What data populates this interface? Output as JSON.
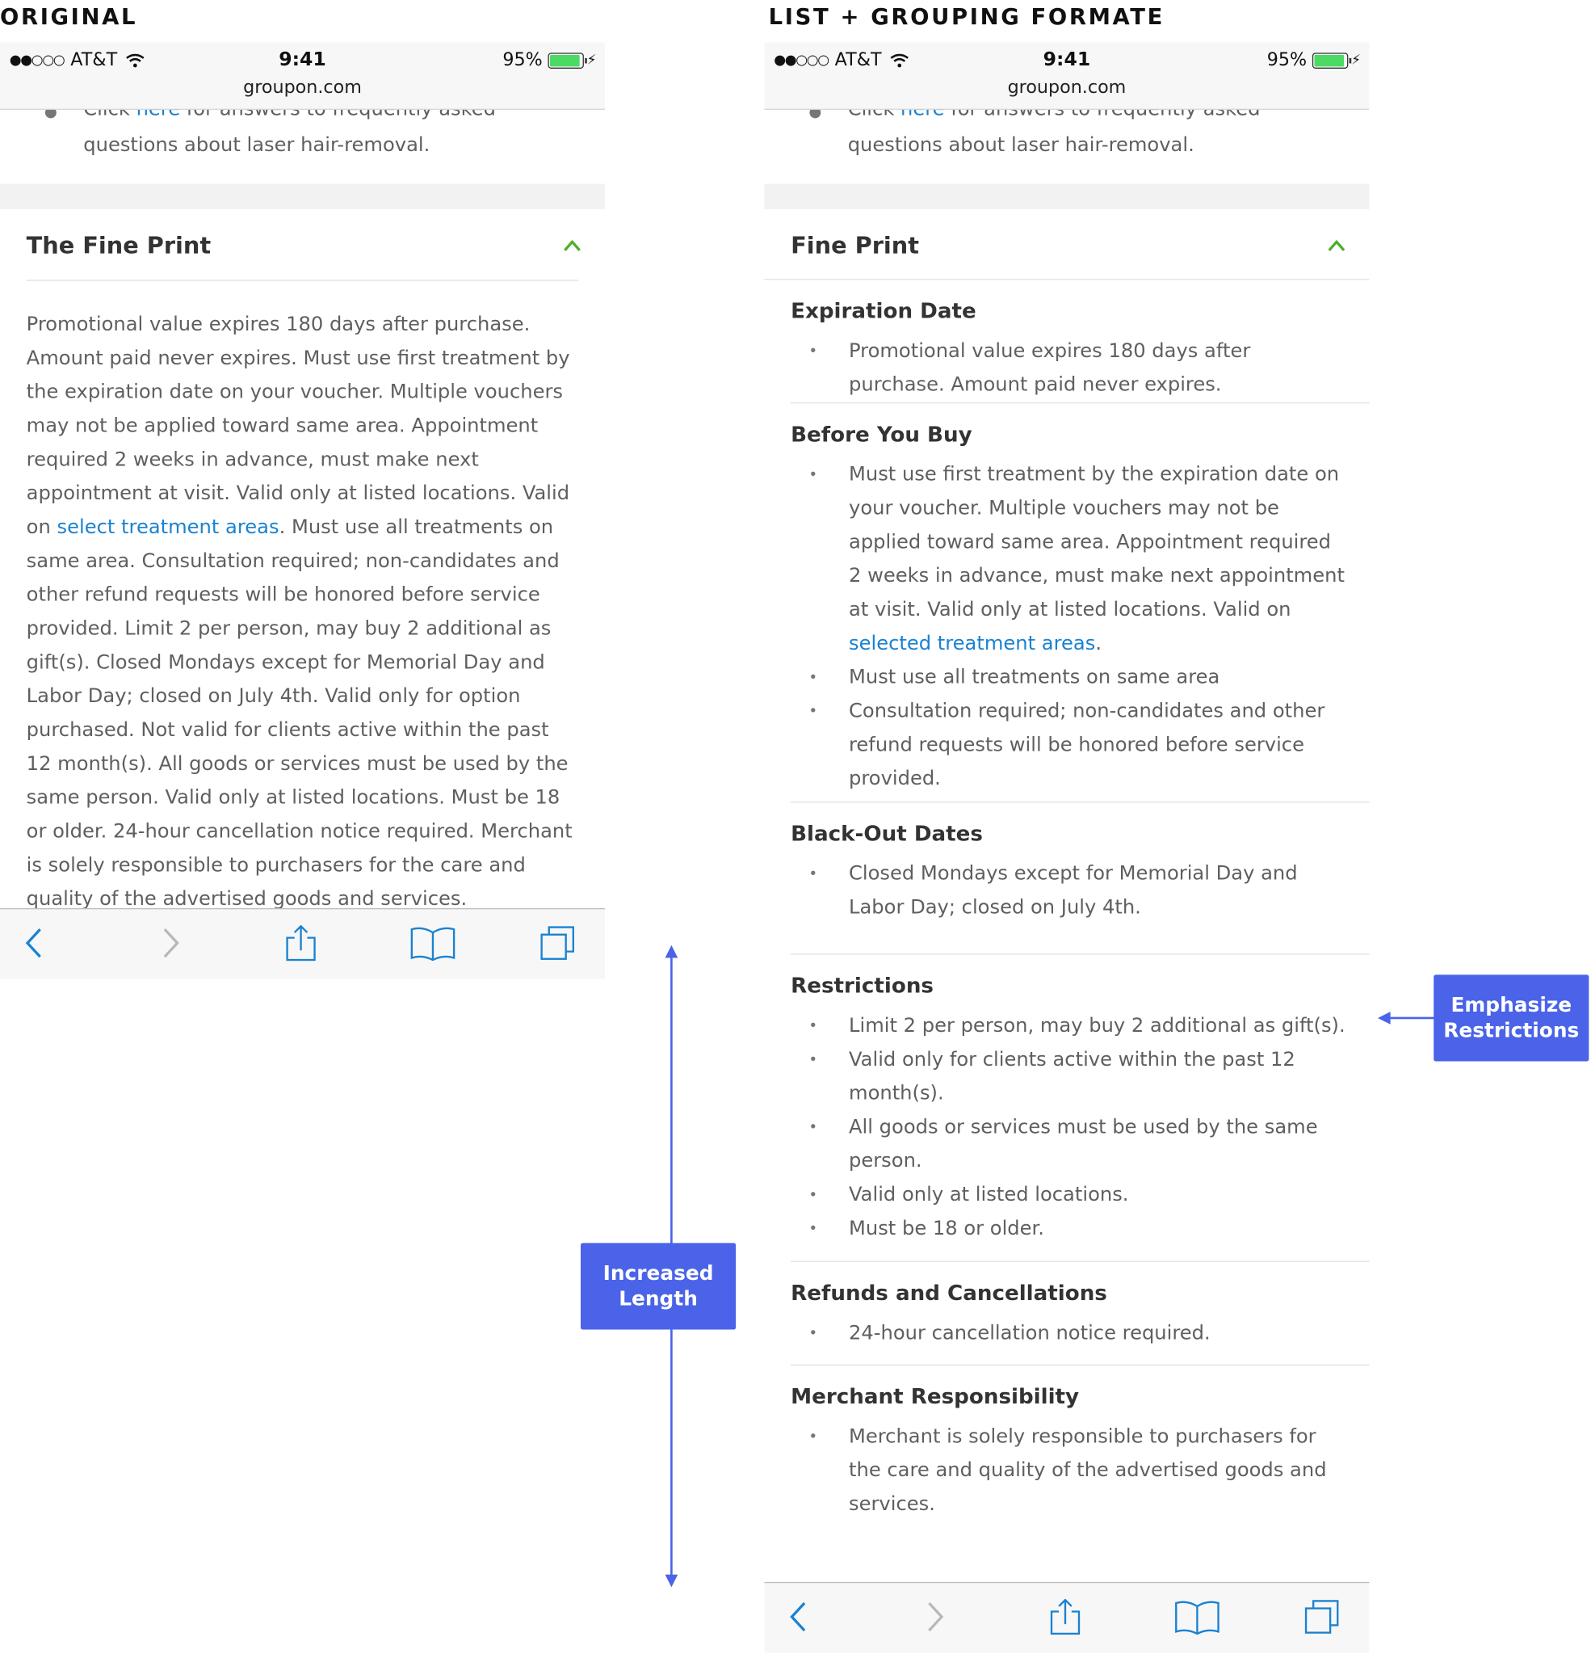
{
  "captions": {
    "left": "ORIGINAL",
    "right": "LIST + GROUPING FORMATE"
  },
  "status": {
    "carrier": "AT&T",
    "time": "9:41",
    "battery": "95%",
    "url": "groupon.com",
    "signal_dots": "●●○○○",
    "charging": "⚡"
  },
  "intro": {
    "line1_prefix": "Click ",
    "line1_link": "here",
    "line1_suffix": " for answers to frequently asked",
    "line2": "questions about laser hair-removal."
  },
  "original": {
    "title": "The Fine Print",
    "text_before_link": "Promotional value expires 180 days after purchase. Amount paid never expires. Must use first treatment by the expiration date on your voucher. Multiple vouchers may not be applied toward same area. Appointment required 2 weeks in advance, must make next appointment at visit. Valid only at listed locations. Valid on ",
    "link": "select treatment areas",
    "text_after_link": ". Must use all treatments on same area. Consultation required; non-candidates and other refund requests will be honored before service provided. Limit 2 per person, may buy 2 additional as gift(s). Closed Mondays except for Memorial Day and Labor Day; closed on July 4th. Valid only for option purchased. Not valid for clients active within the past 12 month(s). All goods or services must be used by the same person. Valid only at listed locations. Must be 18 or older. 24-hour cancellation notice required. Merchant is solely responsible to purchasers for the care and quality of the advertised goods and services."
  },
  "redesign": {
    "title": "Fine Print",
    "sections": {
      "expiration": {
        "title": "Expiration Date",
        "items": [
          "Promotional value expires 180 days after purchase. Amount paid never expires."
        ]
      },
      "before_buy": {
        "title": "Before You Buy",
        "item1_text": "Must use first treatment by the expiration date on your voucher. Multiple vouchers may not be applied toward same area. Appointment required 2 weeks in advance, must make next appointment at visit. Valid only at listed locations. Valid on ",
        "item1_link": "selected treatment areas",
        "item1_end": ".",
        "items": [
          "Must use all treatments on same area",
          "Consultation required; non-candidates and other refund requests will be honored before service provided."
        ]
      },
      "blackout": {
        "title": "Black-Out Dates",
        "items": [
          "Closed Mondays except for Memorial Day and Labor Day; closed on July 4th."
        ]
      },
      "restrictions": {
        "title": "Restrictions",
        "items": [
          "Limit 2 per person, may buy 2 additional as gift(s).",
          "Valid only for clients active within the past 12 month(s).",
          "All goods or services must be used by the same person.",
          "Valid only at listed locations.",
          "Must be 18 or older."
        ]
      },
      "refunds": {
        "title": "Refunds and Cancellations",
        "items": [
          "24-hour cancellation notice required."
        ]
      },
      "merchant": {
        "title": "Merchant Responsibility",
        "items": [
          "Merchant is solely responsible to purchasers for the care and quality of the advertised goods and services."
        ]
      }
    }
  },
  "annotations": {
    "length": "Increased Length",
    "restrictions": "Emphasize Restrictions"
  },
  "colors": {
    "accent_green": "#4caf2a",
    "link_blue": "#1a82d1",
    "annotation_blue": "#4a63e8",
    "toolbar_icon": "#1a82d1"
  },
  "icons": [
    "back-chevron-icon",
    "forward-chevron-icon",
    "share-icon",
    "bookmarks-icon",
    "tabs-icon",
    "collapse-chevron-icon"
  ]
}
